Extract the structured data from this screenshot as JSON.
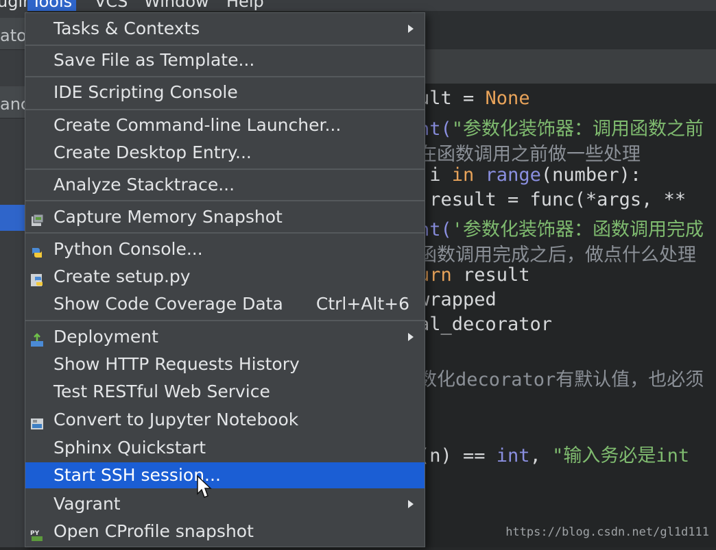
{
  "menubar": {
    "items": [
      {
        "label": "ugin"
      },
      {
        "label": "Tools"
      },
      {
        "label": "VCS"
      },
      {
        "label": "Window"
      },
      {
        "label": "Help"
      }
    ]
  },
  "left": {
    "frag1": "ator",
    "frag2": "anc"
  },
  "tools_menu": {
    "items": [
      {
        "label": "Tasks & Contexts",
        "submenu": true
      },
      {
        "label": "Save File as Template..."
      },
      {
        "label": "IDE Scripting Console"
      },
      {
        "label": "Create Command-line Launcher..."
      },
      {
        "label": "Create Desktop Entry..."
      },
      {
        "label": "Analyze Stacktrace..."
      },
      {
        "label": "Capture Memory Snapshot",
        "icon": "memory-snapshot-icon"
      },
      {
        "label": "Python Console...",
        "icon": "python-icon"
      },
      {
        "label": "Create setup.py",
        "icon": "python-setup-icon"
      },
      {
        "label": "Show Code Coverage Data",
        "shortcut": "Ctrl+Alt+6"
      },
      {
        "label": "Deployment",
        "submenu": true,
        "icon": "deployment-icon"
      },
      {
        "label": "Show HTTP Requests History"
      },
      {
        "label": "Test RESTful Web Service"
      },
      {
        "label": "Convert to Jupyter Notebook",
        "icon": "jupyter-icon"
      },
      {
        "label": "Sphinx Quickstart"
      },
      {
        "label": "Start SSH session...",
        "selected": true
      },
      {
        "label": "Vagrant",
        "submenu": true
      },
      {
        "label": "Open CProfile snapshot",
        "icon": "cprofile-icon"
      }
    ]
  },
  "editor": {
    "lines": [
      {
        "a": "ult = ",
        "b": "None"
      },
      {
        "a": "nt(",
        "b": "\"参数化装饰器：调用函数之前"
      },
      {
        "a": "在函数调用之前做一些处理"
      },
      {
        "a": " i ",
        "b": "in",
        "c": " range",
        "d": "(number):"
      },
      {
        "a": " result = func(*args, **"
      },
      {
        "a": "nt(",
        "b": "'参数化装饰器：函数调用完成"
      },
      {
        "a": "函数调用完成之后，做点什么处理"
      },
      {
        "a": "urn",
        "b": " result"
      },
      {
        "a": "wrapped"
      },
      {
        "a": "al_decorator"
      },
      {
        "a": "数化decorator有默认值，也必须"
      },
      {
        "a": "(n) == ",
        "b": "int",
        "c": ", ",
        "d": "\"输入务必是int"
      }
    ],
    "watermark": "https://blog.csdn.net/gl1d111"
  },
  "colors": {
    "accent": "#1b5ed4",
    "menu_bg": "#404346",
    "editor_bg": "#232526"
  }
}
